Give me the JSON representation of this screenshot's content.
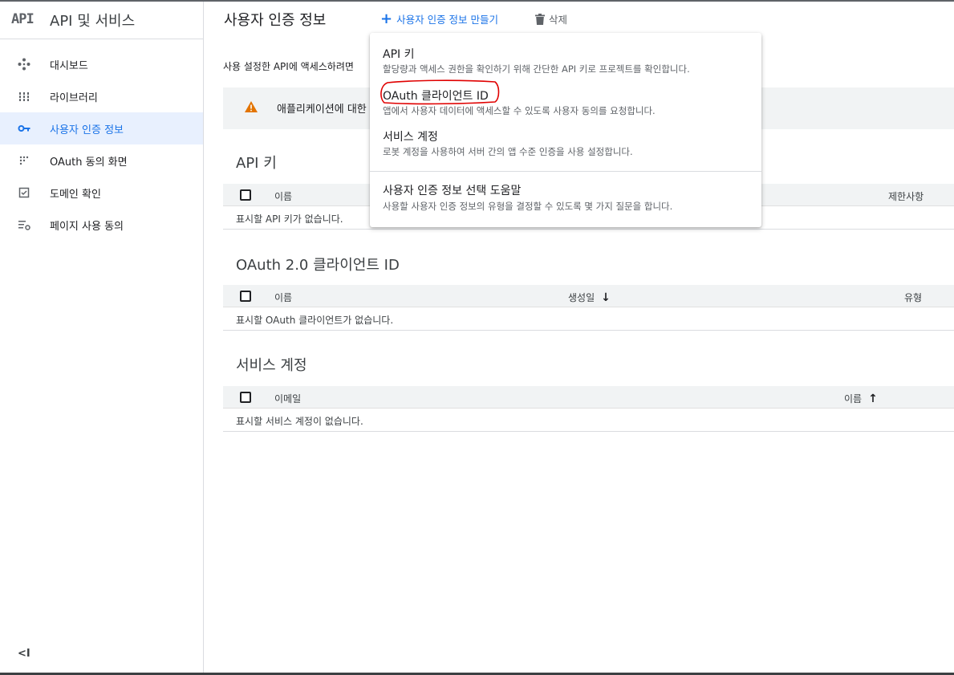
{
  "brand": {
    "logo": "API",
    "title": "API 및 서비스"
  },
  "sidebar": {
    "items": [
      {
        "label": "대시보드",
        "icon": "dashboard-icon"
      },
      {
        "label": "라이브러리",
        "icon": "library-icon"
      },
      {
        "label": "사용자 인증 정보",
        "icon": "key-icon",
        "active": true
      },
      {
        "label": "OAuth 동의 화면",
        "icon": "consent-screen-icon"
      },
      {
        "label": "도메인 확인",
        "icon": "domain-verify-icon"
      },
      {
        "label": "페이지 사용 동의",
        "icon": "page-usage-icon"
      }
    ],
    "collapse_label": "<I"
  },
  "header": {
    "title": "사용자 인증 정보",
    "create_label": "사용자 인증 정보 만들기",
    "delete_label": "삭제"
  },
  "main": {
    "intro": "사용 설정한 API에 액세스하려면",
    "warning": "애플리케이션에 대한"
  },
  "sections": {
    "api_keys": {
      "title": "API 키",
      "col_name": "이름",
      "col_restrictions": "제한사항",
      "empty": "표시할 API 키가 없습니다."
    },
    "oauth": {
      "title": "OAuth 2.0 클라이언트 ID",
      "col_name": "이름",
      "col_created": "생성일",
      "col_type": "유형",
      "empty": "표시할 OAuth 클라이언트가 없습니다."
    },
    "service_accounts": {
      "title": "서비스 계정",
      "col_email": "이메일",
      "col_name": "이름",
      "empty": "표시할 서비스 계정이 없습니다."
    }
  },
  "menu": {
    "items": [
      {
        "title": "API 키",
        "desc": "할당량과 액세스 권한을 확인하기 위해 간단한 API 키로 프로젝트를 확인합니다."
      },
      {
        "title": "OAuth 클라이언트 ID",
        "desc": "앱에서 사용자 데이터에 액세스할 수 있도록 사용자 동의를 요청합니다."
      },
      {
        "title": "서비스 계정",
        "desc": "로봇 계정을 사용하여 서버 간의 앱 수준 인증을 사용 설정합니다."
      },
      {
        "title": "사용자 인증 정보 선택 도움말",
        "desc": "사용할 사용자 인증 정보의 유형을 결정할 수 있도록 몇 가지 질문을 합니다."
      }
    ]
  },
  "colors": {
    "accent": "#1a73e8",
    "active_bg": "#e8f0fe",
    "warning": "#e37400",
    "annotation": "#e00000"
  }
}
